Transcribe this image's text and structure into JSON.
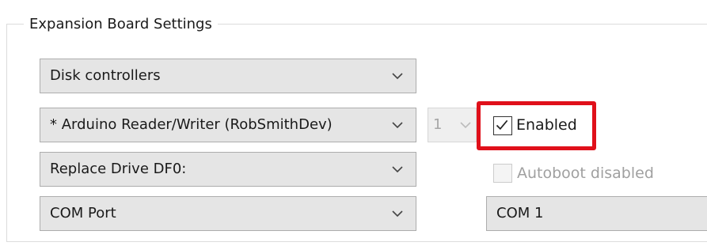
{
  "group": {
    "title": "Expansion Board Settings"
  },
  "combos": {
    "category": {
      "value": "Disk controllers"
    },
    "board": {
      "value": "* Arduino Reader/Writer (RobSmithDev)"
    },
    "board_index": {
      "value": "1"
    },
    "replace": {
      "value": "Replace Drive DF0:"
    },
    "port_type": {
      "value": "COM Port"
    },
    "port": {
      "value": "COM 1"
    }
  },
  "checkboxes": {
    "enabled": {
      "label": "Enabled",
      "checked": true
    },
    "autoboot": {
      "label": "Autoboot disabled",
      "checked": false,
      "disabled": true
    }
  },
  "colors": {
    "highlight": "#e0101a",
    "combo_bg": "#e5e5e5"
  },
  "icons": {
    "dropdown": "chevron-down-icon",
    "check": "checkmark-icon"
  }
}
